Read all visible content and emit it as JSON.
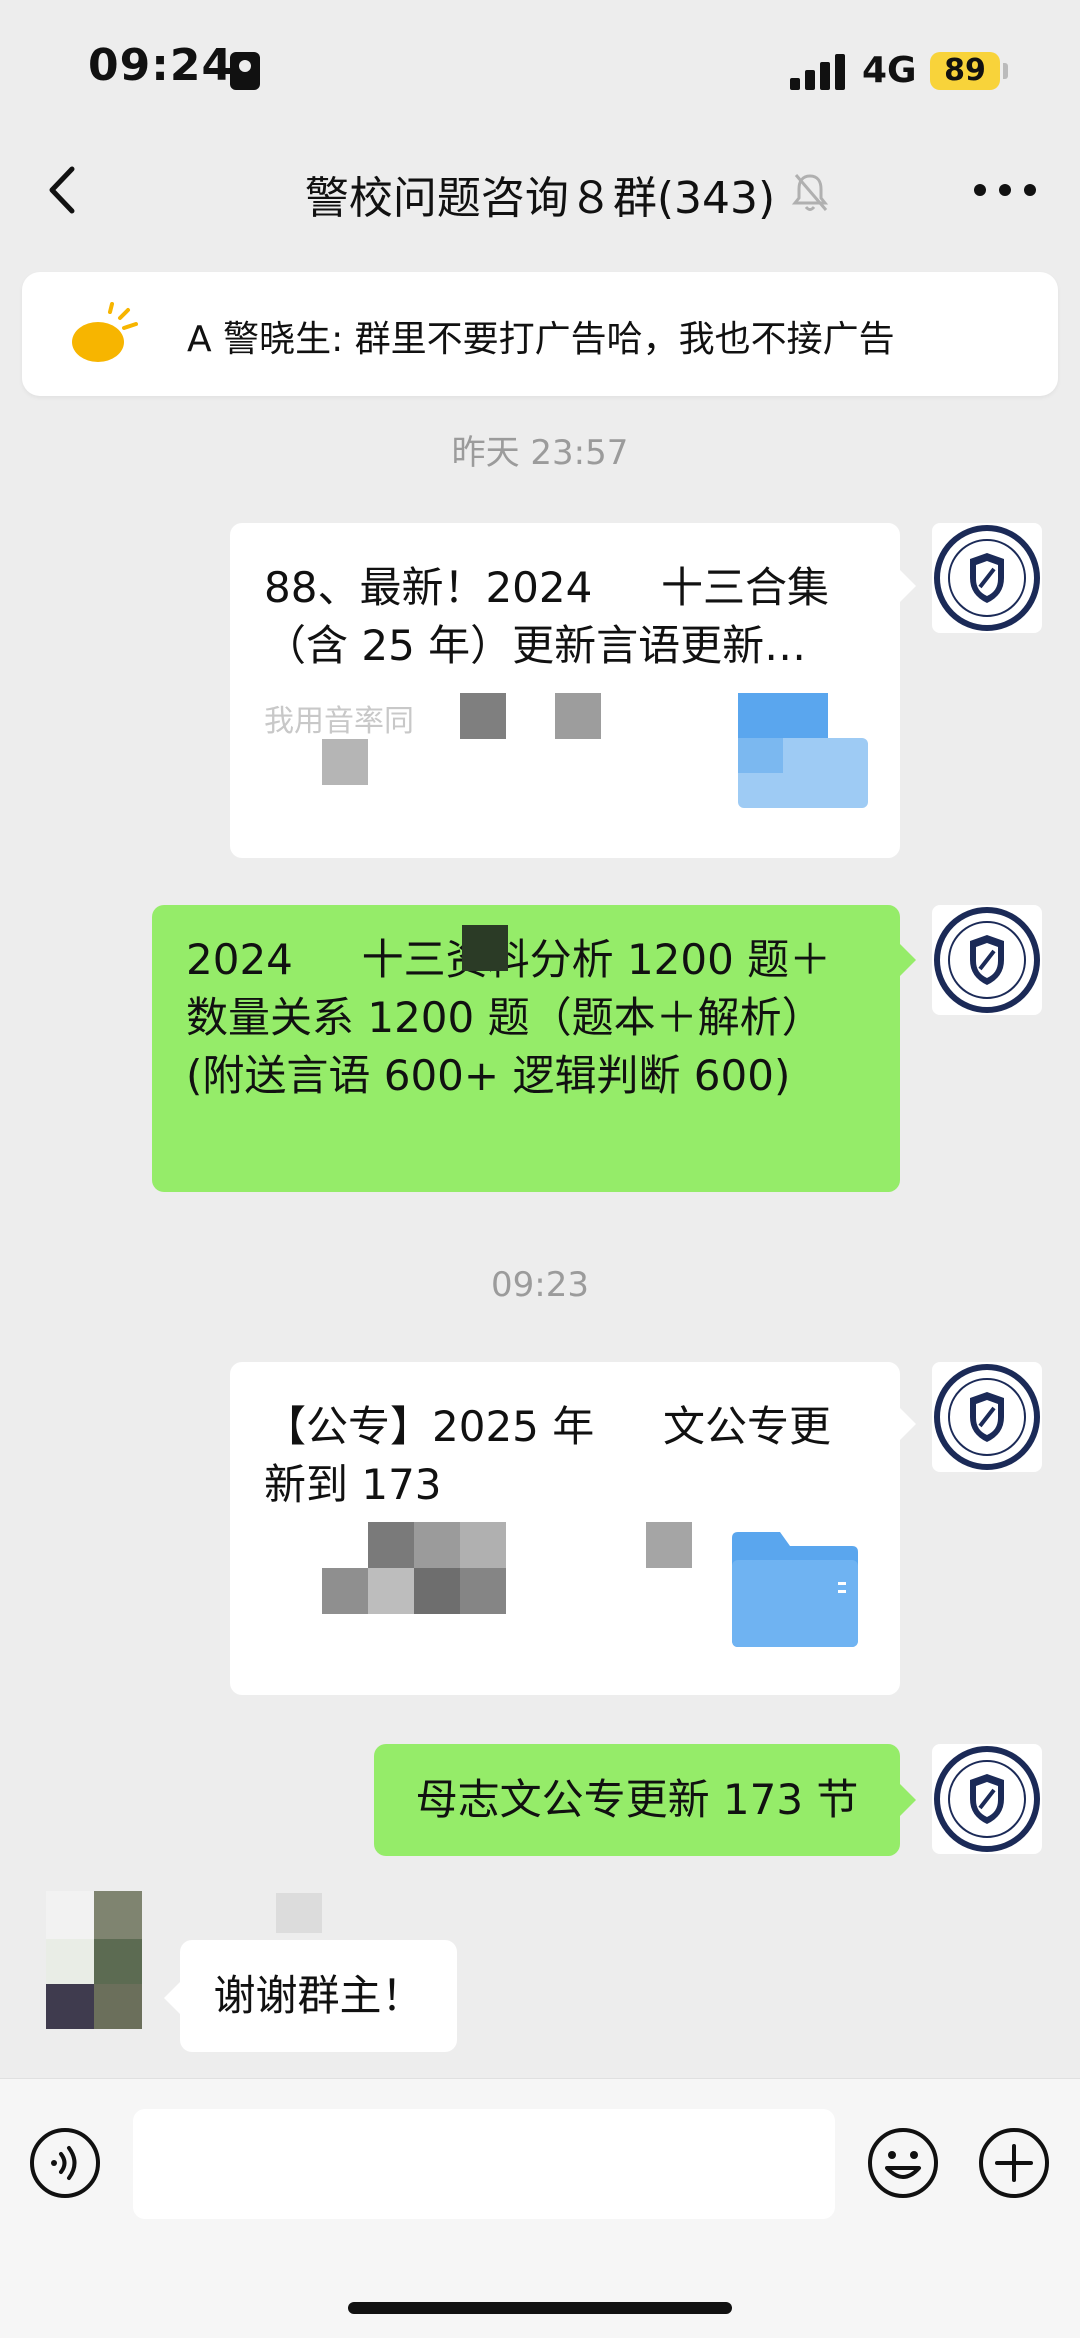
{
  "status_bar": {
    "time": "09:24",
    "network": "4G",
    "battery": "89"
  },
  "nav": {
    "title": "警校问题咨询８群(343)"
  },
  "pinned": {
    "text": "A 警晓生: 群里不要打广告哈，我也不接广告"
  },
  "messages": [
    {
      "type": "timestamp",
      "text": "昨天 23:57"
    },
    {
      "type": "file",
      "title": "88、最新！2024 　 十三合集（含 25 年）更新言语更新…",
      "sub": "我用音率同"
    },
    {
      "type": "text",
      "text": "2024 　 十三资料分析 1200 题＋数量关系 1200 题（题本＋解析）(附送言语 600+ 逻辑判断 600)"
    },
    {
      "type": "timestamp",
      "text": "09:23"
    },
    {
      "type": "file",
      "title": "【公专】2025 年 　 文公专更新到 173",
      "sub": ""
    },
    {
      "type": "text",
      "text": "母志文公专更新 173 节"
    },
    {
      "type": "text",
      "text": "谢谢群主！"
    }
  ],
  "colors": {
    "bg": "#ededed",
    "green_bubble": "#95ec69",
    "battery": "#f8d33a",
    "folder": "#5aa6ee"
  },
  "icons": [
    "back-icon",
    "mute-bell-icon",
    "more-dots-icon",
    "announcement-icon",
    "folder-icon",
    "voice-icon",
    "emoji-icon",
    "plus-icon"
  ]
}
